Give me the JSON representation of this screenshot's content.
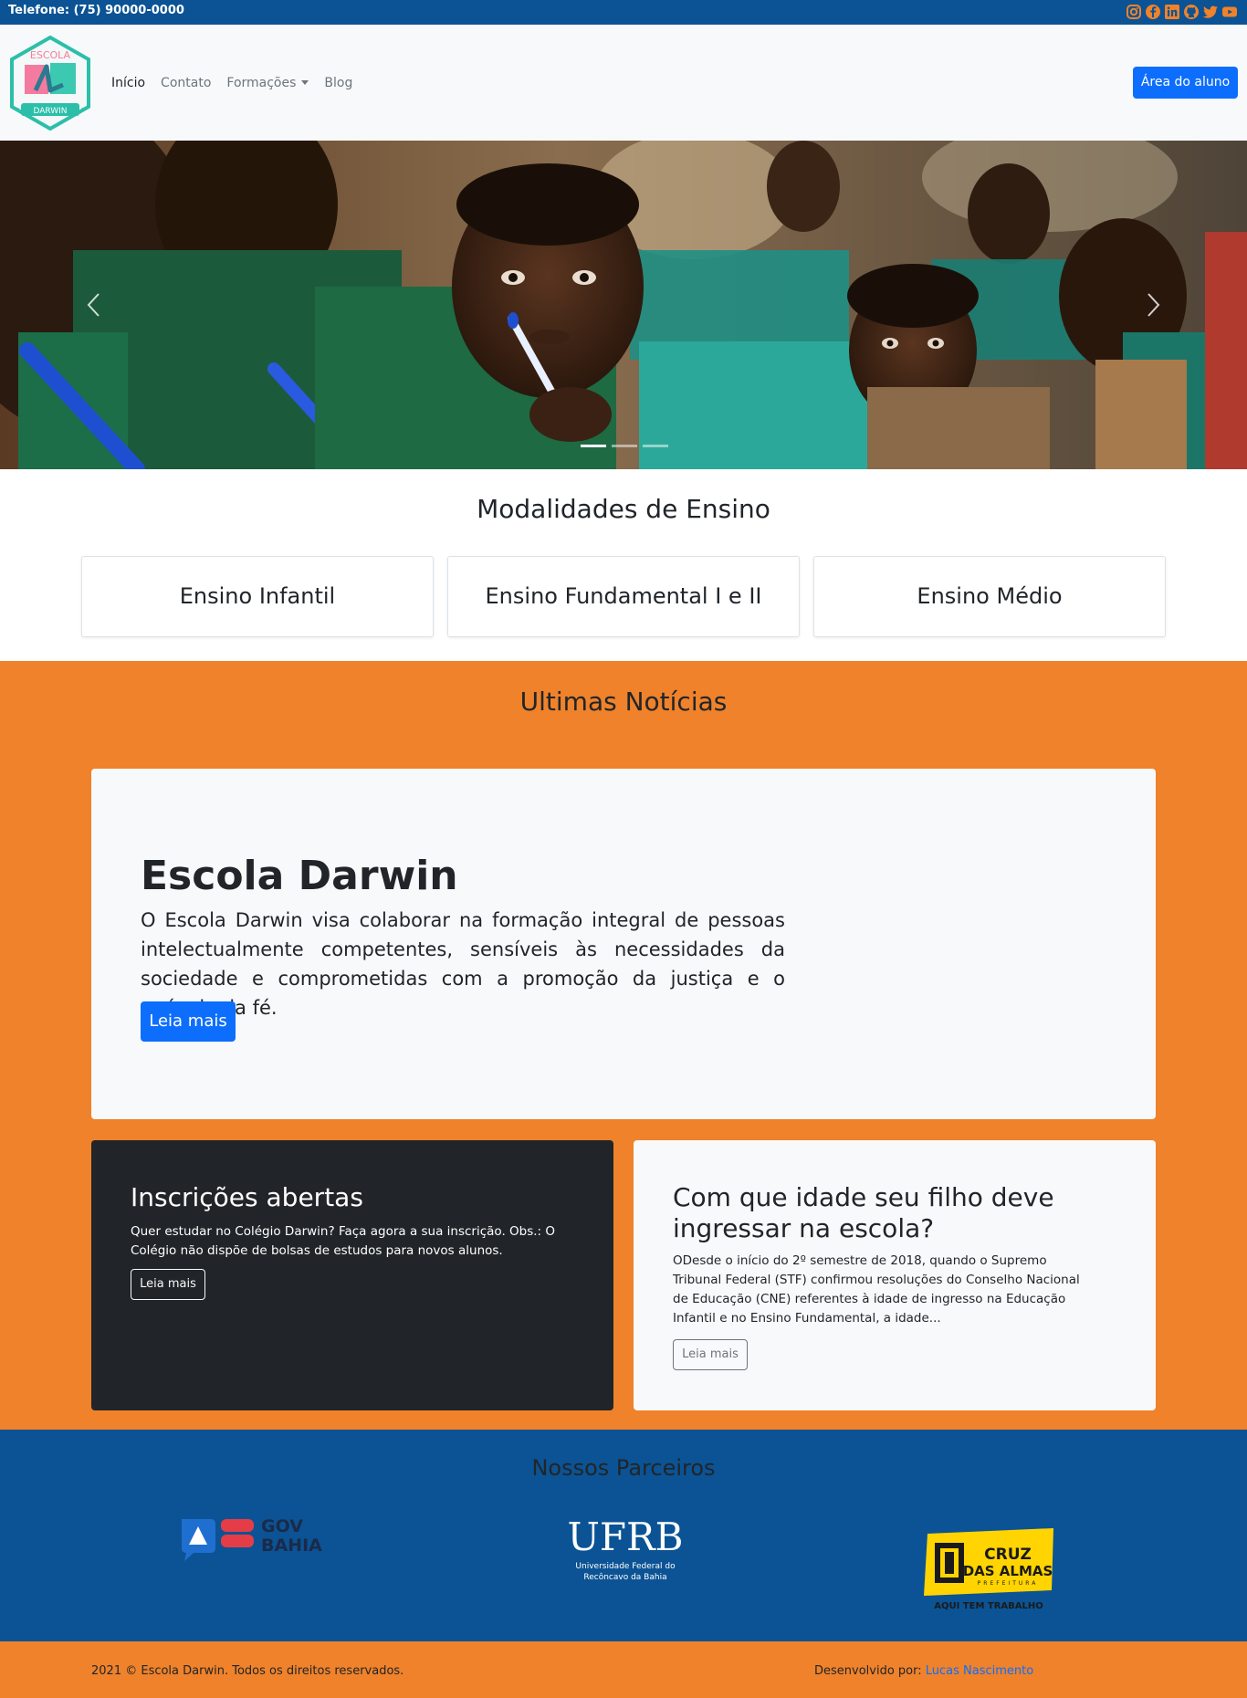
{
  "topbar": {
    "phone": "Telefone: (75) 90000-0000",
    "social_icons": [
      "instagram-icon",
      "facebook-icon",
      "linkedin-icon",
      "github-icon",
      "twitter-icon",
      "youtube-icon"
    ],
    "icon_color": "#ef822a"
  },
  "navbar": {
    "logo_text_top": "ESCOLA",
    "logo_text_bottom": "DARWIN",
    "links": [
      "Início",
      "Contato",
      "Formações",
      "Blog"
    ],
    "aluno_button": "Área do aluno"
  },
  "hero": {
    "prev_icon": "chevron-left-icon",
    "next_icon": "chevron-right-icon",
    "slides": 3,
    "active_slide": 1
  },
  "modalidades": {
    "title": "Modalidades de Ensino",
    "items": [
      "Ensino Infantil",
      "Ensino Fundamental I e II",
      "Ensino Médio"
    ]
  },
  "noticias": {
    "title": "Ultimas Notícias",
    "featured": {
      "title": "Escola Darwin",
      "text": "O Escola Darwin visa colaborar na formação integral de pessoas intelectualmente competentes, sensíveis às necessidades da sociedade e comprometidas com a promoção da justiça e o anúncio da fé.",
      "button": "Leia mais"
    },
    "card1": {
      "title": "Inscrições abertas",
      "text": "Quer estudar no Colégio Darwin? Faça agora a sua inscrição. Obs.: O Colégio não dispõe de bolsas de estudos para novos alunos.",
      "button": "Leia mais"
    },
    "card2": {
      "title": "Com que idade seu filho deve ingressar na escola?",
      "text": "ODesde o início do 2º semestre de 2018, quando o Supremo Tribunal Federal (STF) confirmou resoluções do Conselho Nacional de Educação (CNE) referentes à idade de ingresso na Educação Infantil e no Ensino Fundamental, a idade...",
      "button": "Leia mais"
    }
  },
  "parceiros": {
    "title": "Nossos Parceiros",
    "govbahia": {
      "line1": "GOV",
      "line2": "BAHIA"
    },
    "ufrb": {
      "name": "UFRB",
      "sub1": "Universidade Federal do",
      "sub2": "Recôncavo da Bahia"
    },
    "cruz": {
      "line1": "CRUZ",
      "line2": "DAS ALMAS",
      "line3": "PREFEITURA",
      "slogan": "AQUI TEM TRABALHO"
    }
  },
  "footer": {
    "copyright": "2021 © Escola Darwin. Todos os direitos reservados.",
    "dev_label": "Desenvolvido por:",
    "dev_name": "Lucas Nascimento"
  },
  "colors": {
    "blue": "#0b5394",
    "orange": "#ef822a",
    "primary": "#0d6efd",
    "dark": "#212529",
    "light": "#f8f9fa"
  }
}
